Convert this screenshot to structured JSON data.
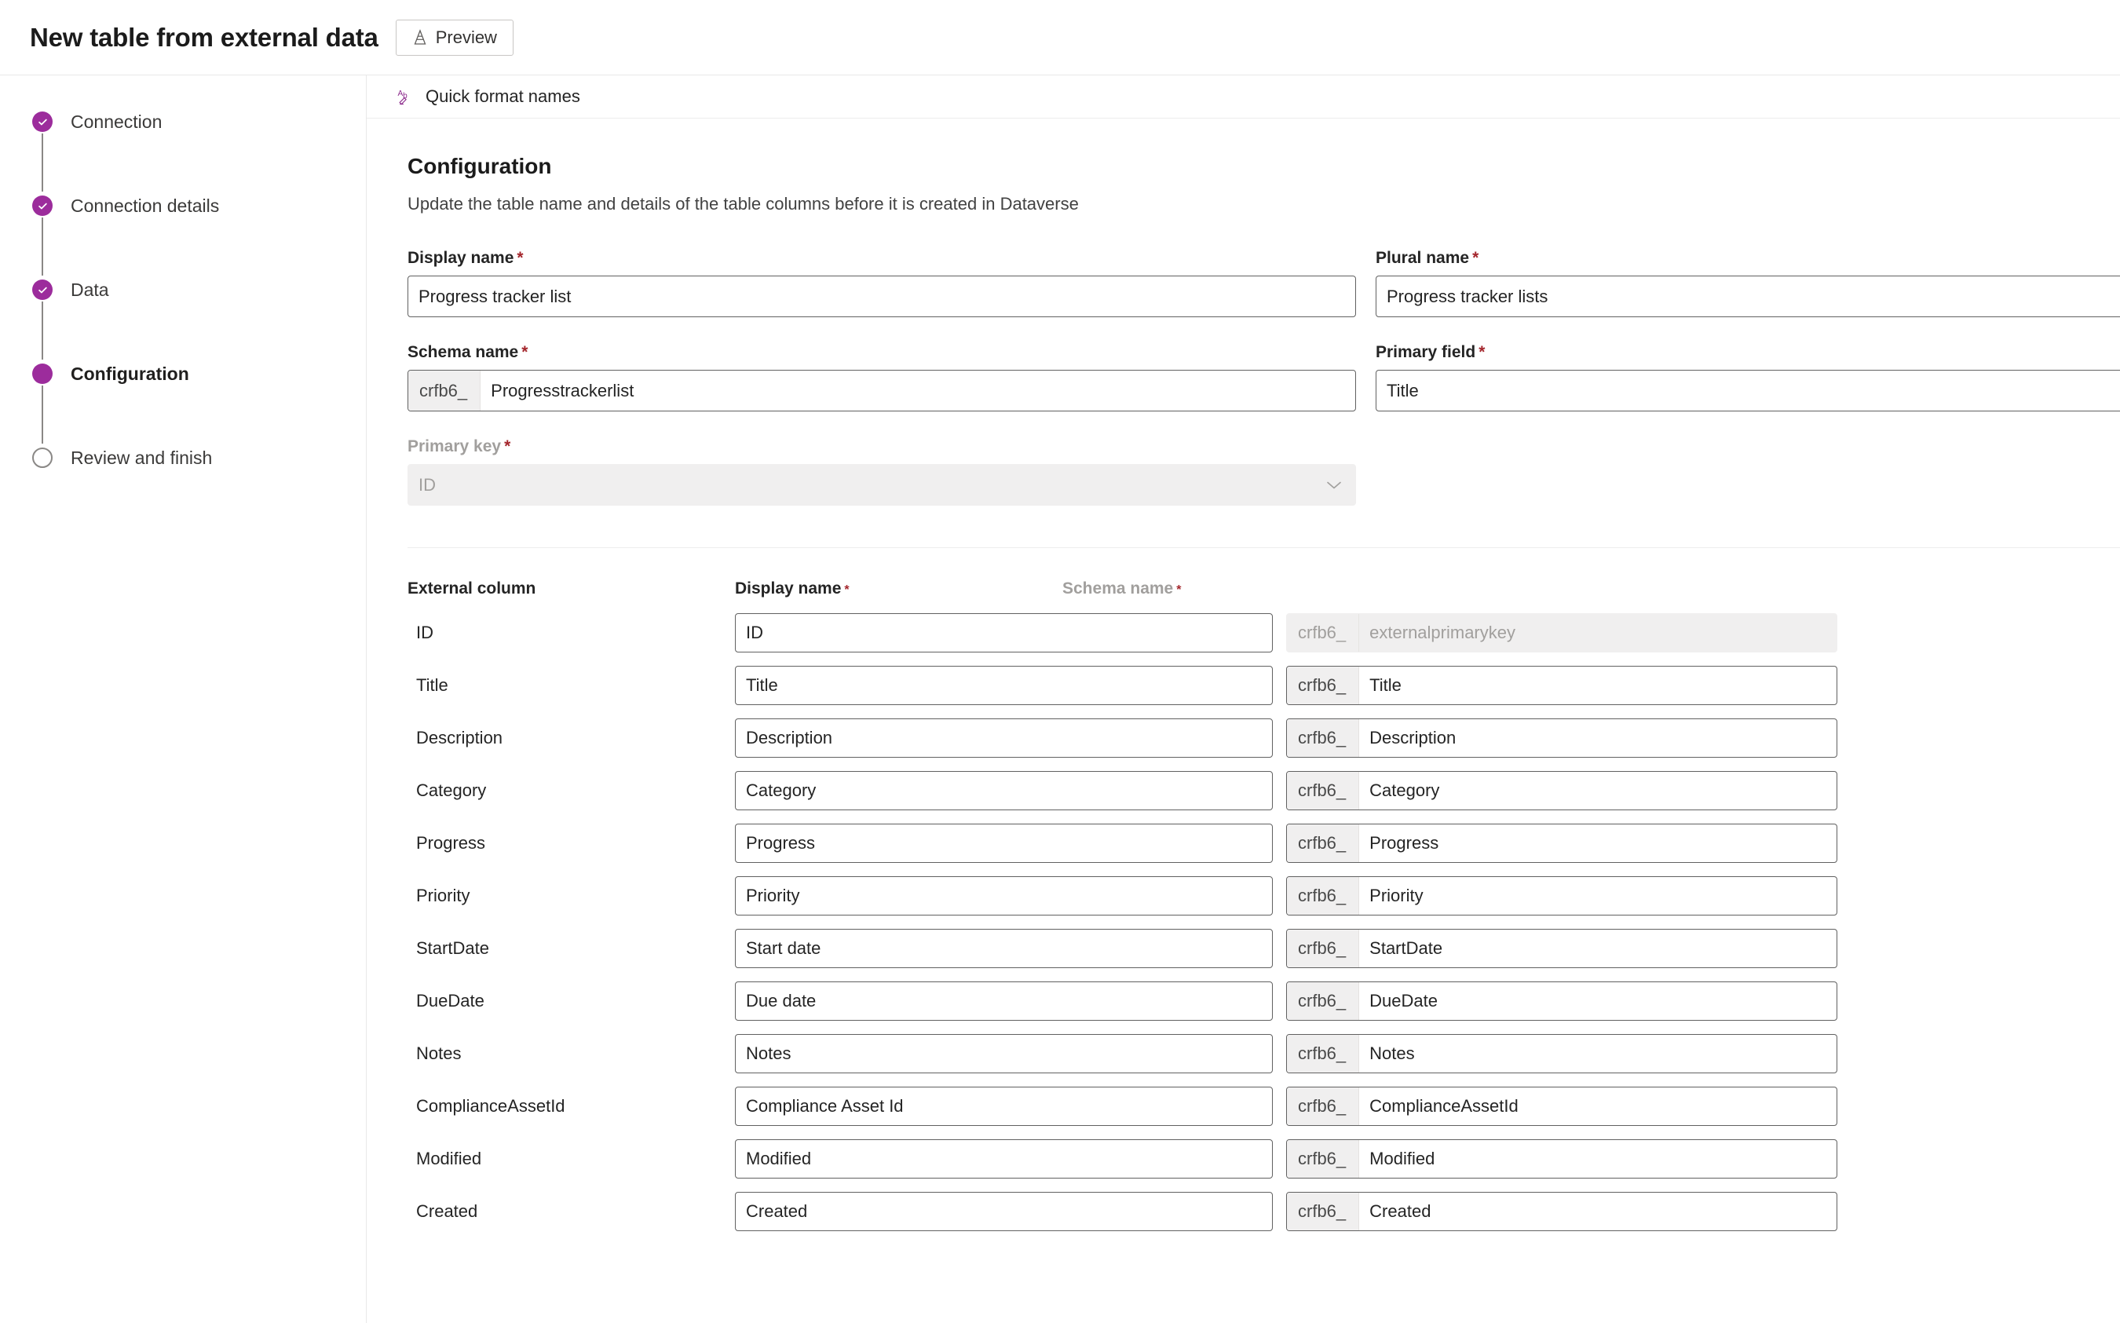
{
  "header": {
    "title": "New table from external data",
    "preview_label": "Preview",
    "preview_icon": "preview-cone-icon"
  },
  "stepper": {
    "items": [
      {
        "label": "Connection",
        "state": "complete",
        "icon": "check-icon"
      },
      {
        "label": "Connection details",
        "state": "complete",
        "icon": "check-icon"
      },
      {
        "label": "Data",
        "state": "complete",
        "icon": "check-icon"
      },
      {
        "label": "Configuration",
        "state": "current",
        "icon": "filled-dot-icon"
      },
      {
        "label": "Review and finish",
        "state": "pending",
        "icon": "empty-circle-icon"
      }
    ]
  },
  "toolbar": {
    "quick_format_label": "Quick format names",
    "quick_format_icon": "ab-format-icon"
  },
  "configuration": {
    "title": "Configuration",
    "description": "Update the table name and details of the table columns before it is created in Dataverse",
    "fields": {
      "display_name": {
        "label": "Display name",
        "required": true,
        "value": "Progress tracker list"
      },
      "plural_name": {
        "label": "Plural name",
        "required": true,
        "value": "Progress tracker lists"
      },
      "schema_name": {
        "label": "Schema name",
        "required": true,
        "prefix": "crfb6_",
        "value": "Progresstrackerlist"
      },
      "primary_field": {
        "label": "Primary field",
        "required": true,
        "value": "Title"
      },
      "primary_key": {
        "label": "Primary key",
        "required": true,
        "value": "ID",
        "disabled": true,
        "icon": "chevron-down-icon"
      }
    }
  },
  "columns_table": {
    "headers": {
      "external_column": "External column",
      "display_name": "Display name",
      "display_name_required": true,
      "schema_name": "Schema name",
      "schema_name_required": true
    },
    "schema_prefix": "crfb6_",
    "rows": [
      {
        "external": "ID",
        "display": "ID",
        "schema": "externalprimarykey",
        "schema_disabled": true
      },
      {
        "external": "Title",
        "display": "Title",
        "schema": "Title",
        "schema_disabled": false
      },
      {
        "external": "Description",
        "display": "Description",
        "schema": "Description",
        "schema_disabled": false
      },
      {
        "external": "Category",
        "display": "Category",
        "schema": "Category",
        "schema_disabled": false
      },
      {
        "external": "Progress",
        "display": "Progress",
        "schema": "Progress",
        "schema_disabled": false
      },
      {
        "external": "Priority",
        "display": "Priority",
        "schema": "Priority",
        "schema_disabled": false
      },
      {
        "external": "StartDate",
        "display": "Start date",
        "schema": "StartDate",
        "schema_disabled": false
      },
      {
        "external": "DueDate",
        "display": "Due date",
        "schema": "DueDate",
        "schema_disabled": false
      },
      {
        "external": "Notes",
        "display": "Notes",
        "schema": "Notes",
        "schema_disabled": false
      },
      {
        "external": "ComplianceAssetId",
        "display": "Compliance Asset Id",
        "schema": "ComplianceAssetId",
        "schema_disabled": false
      },
      {
        "external": "Modified",
        "display": "Modified",
        "schema": "Modified",
        "schema_disabled": false
      },
      {
        "external": "Created",
        "display": "Created",
        "schema": "Created",
        "schema_disabled": false
      }
    ]
  },
  "colors": {
    "accent_purple": "#9c2c9c",
    "required_red": "#a4262c",
    "border_gray": "#616161",
    "disabled_bg": "#f0efef"
  }
}
